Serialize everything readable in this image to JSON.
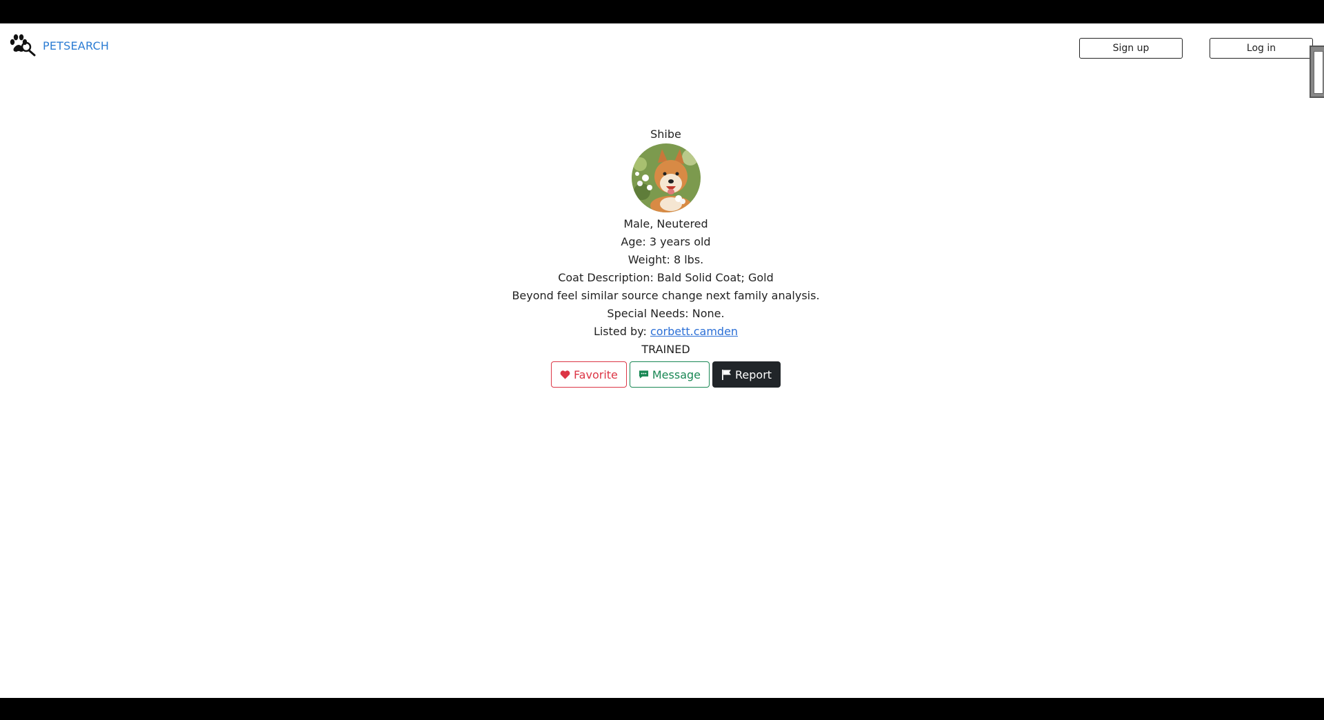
{
  "header": {
    "brand_name": "PETSEARCH",
    "signup_label": "Sign up",
    "login_label": "Log in"
  },
  "pet": {
    "name": "Shibe",
    "sex": "Male, Neutered",
    "age": "Age: 3 years old",
    "weight": "Weight: 8 lbs.",
    "coat": "Coat Description: Bald Solid Coat; Gold",
    "description": "Beyond feel similar source change next family analysis.",
    "special_needs": "Special Needs: None.",
    "listed_by_prefix": "Listed by: ",
    "listed_by_user": "corbett.camden",
    "status": "TRAINED"
  },
  "actions": {
    "favorite_label": "Favorite",
    "message_label": "Message",
    "report_label": "Report"
  },
  "colors": {
    "brand": "#2b7cd3",
    "favorite": "#dc3545",
    "message": "#198754",
    "report": "#212529",
    "link": "#2b6fd6"
  },
  "icons": {
    "brand": "paw-search-icon",
    "favorite": "heart-icon",
    "message": "chat-icon",
    "report": "flag-icon"
  }
}
